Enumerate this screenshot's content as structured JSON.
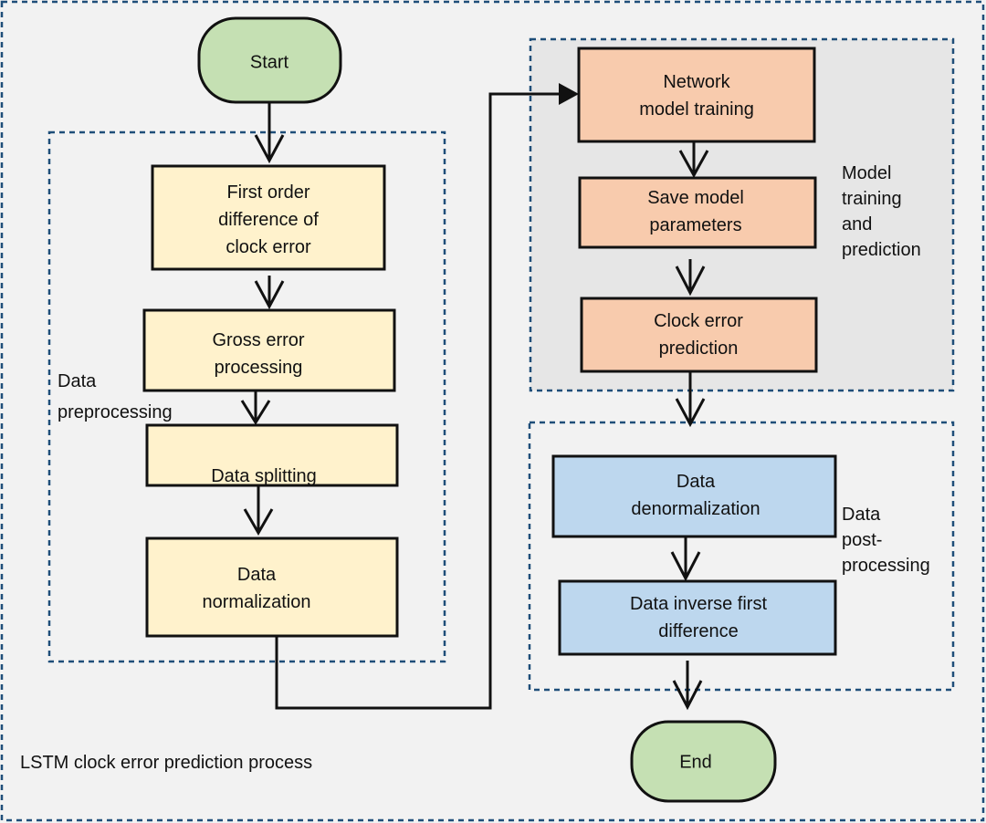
{
  "title": "LSTM clock error prediction process",
  "colors": {
    "background": "#f2f2f2",
    "frame": "#1f4e79",
    "terminal": "#c5e0b3",
    "preprocessing": "#fff2cc",
    "training": "#f8cbad",
    "training_group_bg": "#e6e6e6",
    "postprocessing": "#bdd7ee"
  },
  "terminals": {
    "start": "Start",
    "end": "End"
  },
  "groups": {
    "preprocessing": {
      "label_lines": [
        "Data",
        "preprocessing"
      ]
    },
    "training": {
      "label_lines": [
        "Model",
        "training",
        "and",
        "prediction"
      ]
    },
    "postprocessing": {
      "label_lines": [
        "Data",
        "post-",
        "processing"
      ]
    }
  },
  "steps": {
    "first_diff": {
      "lines": [
        "First order",
        "difference of",
        "clock error"
      ]
    },
    "gross_error": {
      "lines": [
        "Gross error",
        "processing"
      ]
    },
    "splitting": {
      "lines": [
        "Data splitting"
      ]
    },
    "normalization": {
      "lines": [
        "Data",
        "normalization"
      ]
    },
    "network_training": {
      "lines": [
        "Network",
        "model training"
      ]
    },
    "save_params": {
      "lines": [
        "Save model",
        "parameters"
      ]
    },
    "clock_prediction": {
      "lines": [
        "Clock error",
        "prediction"
      ]
    },
    "denormalization": {
      "lines": [
        "Data",
        "denormalization"
      ]
    },
    "inverse_diff": {
      "lines": [
        "Data inverse first",
        "difference"
      ]
    }
  }
}
